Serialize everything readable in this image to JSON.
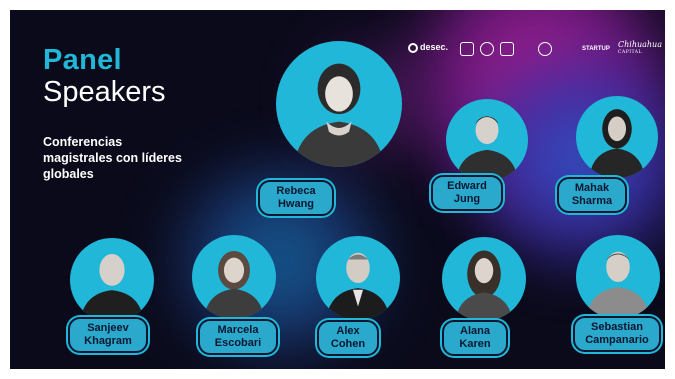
{
  "header": {
    "title_line1": "Panel",
    "title_line2": "Speakers",
    "subtitle": "Conferencias magistrales con líderes globales"
  },
  "logos": {
    "desec": "desec.",
    "startup": "STARTUP",
    "capital_script": "Chihuahua",
    "capital_text": "CAPITAL"
  },
  "speakers": [
    {
      "first": "Rebeca",
      "last": "Hwang"
    },
    {
      "first": "Edward",
      "last": "Jung"
    },
    {
      "first": "Mahak",
      "last": "Sharma"
    },
    {
      "first": "Sanjeev",
      "last": "Khagram"
    },
    {
      "first": "Marcela",
      "last": "Escobari"
    },
    {
      "first": "Alex",
      "last": "Cohen"
    },
    {
      "first": "Alana",
      "last": "Karen"
    },
    {
      "first": "Sebastian",
      "last": "Campanario"
    }
  ],
  "colors": {
    "accent": "#21b7d8",
    "background": "#0a0a1a",
    "tag_text": "#0b1730"
  }
}
